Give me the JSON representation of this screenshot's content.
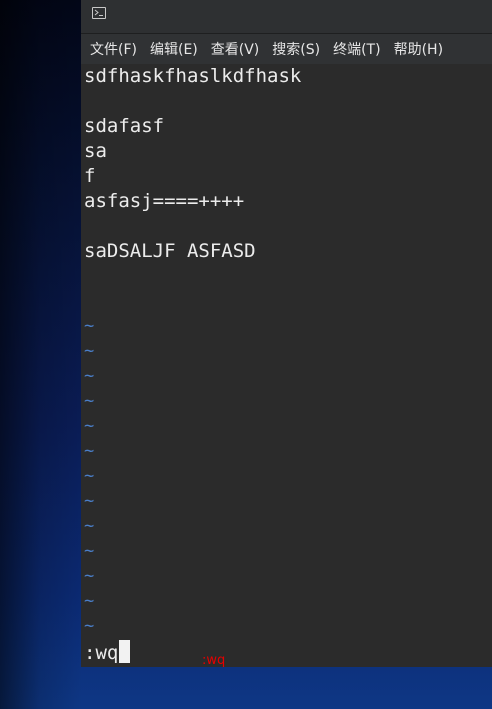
{
  "window": {
    "icon": "terminal-icon"
  },
  "menubar": {
    "items": [
      {
        "label": "文件(F)"
      },
      {
        "label": "编辑(E)"
      },
      {
        "label": "查看(V)"
      },
      {
        "label": "搜索(S)"
      },
      {
        "label": "终端(T)"
      },
      {
        "label": "帮助(H)"
      }
    ]
  },
  "editor": {
    "lines": [
      "sdfhaskfhaslkdfhask",
      "",
      "sdafasf",
      "sa",
      "f",
      "asfasj====++++",
      "",
      "saDSALJF ASFASD",
      "",
      ""
    ],
    "empty_marker": "~",
    "empty_line_count": 13,
    "command": ":wq"
  },
  "annotation": {
    "text": ":wq",
    "color": "#e60000"
  },
  "colors": {
    "terminal_bg": "#2b2b2b",
    "text": "#ececec",
    "tilde": "#4a7ec8"
  }
}
